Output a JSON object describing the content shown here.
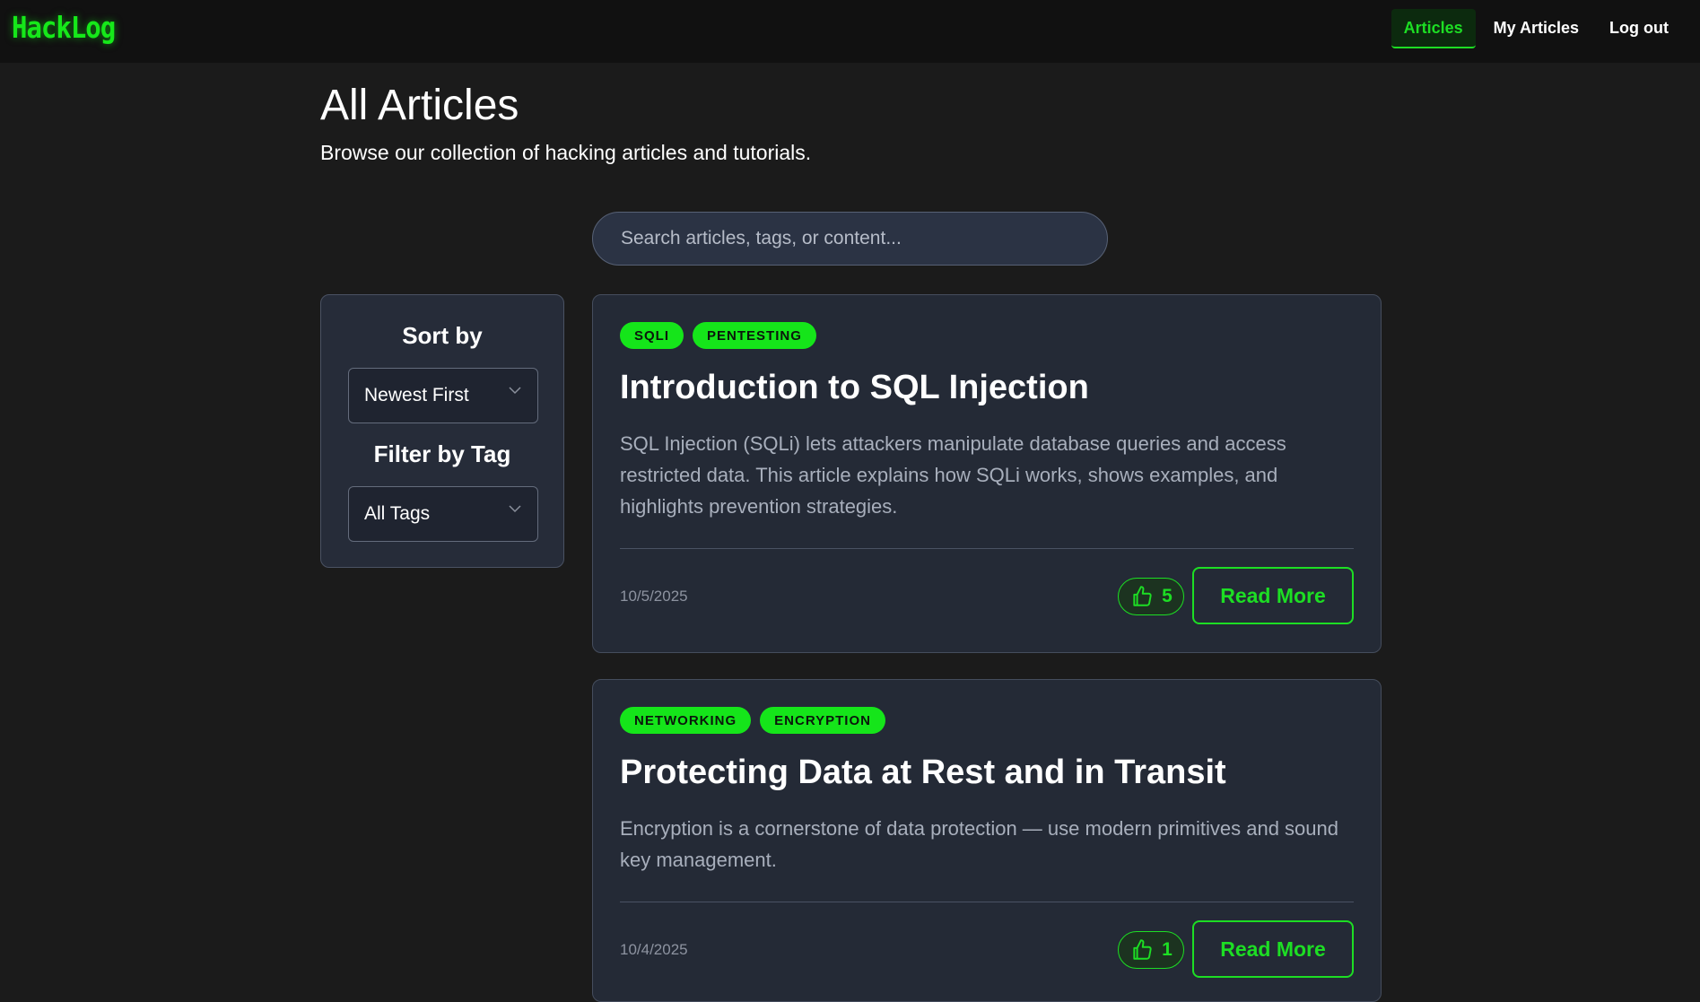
{
  "brand": {
    "logo": "HackLog"
  },
  "nav": {
    "articles": "Articles",
    "my_articles": "My Articles",
    "logout": "Log out"
  },
  "header": {
    "title": "All Articles",
    "subtitle": "Browse our collection of hacking articles and tutorials."
  },
  "search": {
    "placeholder": "Search articles, tags, or content..."
  },
  "sidebar": {
    "sort_heading": "Sort by",
    "sort_value": "Newest First",
    "filter_heading": "Filter by Tag",
    "filter_value": "All Tags"
  },
  "articles": [
    {
      "tags": [
        "SQLI",
        "PENTESTING"
      ],
      "title": "Introduction to SQL Injection",
      "excerpt": "SQL Injection (SQLi) lets attackers manipulate database queries and access restricted data. This article explains how SQLi works, shows examples, and highlights prevention strategies.",
      "date": "10/5/2025",
      "likes": "5",
      "read_more": "Read More"
    },
    {
      "tags": [
        "NETWORKING",
        "ENCRYPTION"
      ],
      "title": "Protecting Data at Rest and in Transit",
      "excerpt": "Encryption is a cornerstone of data protection — use modern primitives and sound key management.",
      "date": "10/4/2025",
      "likes": "1",
      "read_more": "Read More"
    }
  ],
  "icons": {
    "like": "thumbs-up-icon",
    "dropdown": "chevron-down-icon"
  },
  "colors": {
    "accent": "#1dde24",
    "background": "#1b1b1b",
    "card": "#242a36"
  }
}
